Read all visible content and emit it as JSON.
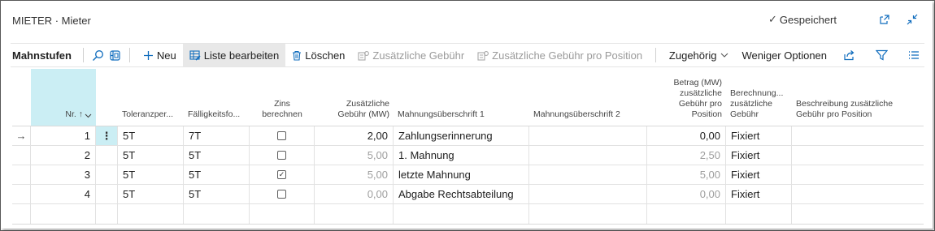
{
  "window": {
    "title": "MIETER · Mieter",
    "saved_label": "Gespeichert",
    "icons": [
      "open-new-window-icon",
      "collapse-icon"
    ]
  },
  "toolbar": {
    "title": "Mahnstufen",
    "search_icon": "search-icon",
    "layout_icon": "layout-icon",
    "new_label": "Neu",
    "edit_list_label": "Liste bearbeiten",
    "delete_label": "Löschen",
    "add_fee_label": "Zusätzliche Gebühr",
    "add_fee_per_line_label": "Zusätzliche Gebühr pro Position",
    "related_label": "Zugehörig",
    "fewer_options_label": "Weniger Optionen",
    "share_icon": "share-icon",
    "filter_icon": "filter-icon",
    "list_icon": "list-icon"
  },
  "table": {
    "headers": {
      "no": "Nr. ↑",
      "tolerance": "Toleranzper...",
      "due_date": "Fälligkeitsfo...",
      "calc_interest": "Zins berechnen",
      "add_fee": "Zusätzliche Gebühr (MW)",
      "header1": "Mahnungsüberschrift 1",
      "header2": "Mahnungsüberschrift 2",
      "fee_per_line": "Betrag (MW) zusätzliche Gebühr pro Position",
      "calc_fee": "Berechnung... zusätzliche Gebühr",
      "fee_desc": "Beschreibung zusätzliche Gebühr pro Position"
    },
    "rows": [
      {
        "no": "1",
        "tolerance": "5T",
        "due_date": "7T",
        "calc_interest": false,
        "add_fee": "2,00",
        "header1": "Zahlungserinnerung",
        "header2": "",
        "fee_per_line": "0,00",
        "calc_fee": "Fixiert",
        "fee_desc": ""
      },
      {
        "no": "2",
        "tolerance": "5T",
        "due_date": "5T",
        "calc_interest": false,
        "add_fee": "5,00",
        "header1": "1. Mahnung",
        "header2": "",
        "fee_per_line": "2,50",
        "calc_fee": "Fixiert",
        "fee_desc": ""
      },
      {
        "no": "3",
        "tolerance": "5T",
        "due_date": "5T",
        "calc_interest": true,
        "add_fee": "5,00",
        "header1": "letzte Mahnung",
        "header2": "",
        "fee_per_line": "5,00",
        "calc_fee": "Fixiert",
        "fee_desc": ""
      },
      {
        "no": "4",
        "tolerance": "5T",
        "due_date": "5T",
        "calc_interest": false,
        "add_fee": "0,00",
        "header1": "Abgabe Rechtsabteilung",
        "header2": "",
        "fee_per_line": "0,00",
        "calc_fee": "Fixiert",
        "fee_desc": ""
      }
    ]
  },
  "colors": {
    "accent": "#0f6cbd",
    "selection": "#cbeef4",
    "muted_text": "#9e9e9e"
  }
}
